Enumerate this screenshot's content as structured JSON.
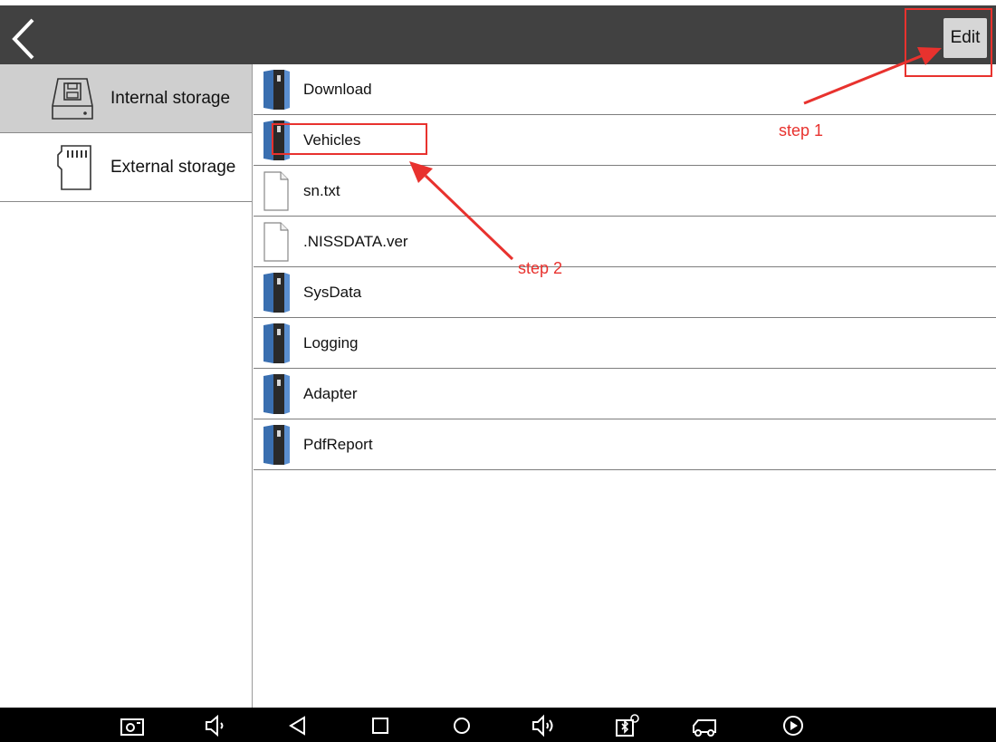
{
  "topbar": {
    "edit_label": "Edit"
  },
  "sidebar": {
    "items": [
      {
        "label": "Internal storage",
        "icon": "floppy-drive-icon",
        "active": true
      },
      {
        "label": "External storage",
        "icon": "sd-card-icon",
        "active": false
      }
    ]
  },
  "files": [
    {
      "name": "Download",
      "type": "folder"
    },
    {
      "name": "Vehicles",
      "type": "folder"
    },
    {
      "name": "sn.txt",
      "type": "file"
    },
    {
      "name": ".NISSDATA.ver",
      "type": "file"
    },
    {
      "name": "SysData",
      "type": "folder"
    },
    {
      "name": "Logging",
      "type": "folder"
    },
    {
      "name": "Adapter",
      "type": "folder"
    },
    {
      "name": "PdfReport",
      "type": "folder"
    }
  ],
  "annotations": {
    "step1": "step 1",
    "step2": "step 2",
    "color": "#e8322e"
  },
  "navbar": {
    "buttons": [
      "screenshot-icon",
      "volume-down-icon",
      "back-triangle-icon",
      "recents-square-icon",
      "home-circle-icon",
      "volume-up-icon",
      "vci-bluetooth-icon",
      "vehicle-icon",
      "play-icon"
    ]
  }
}
